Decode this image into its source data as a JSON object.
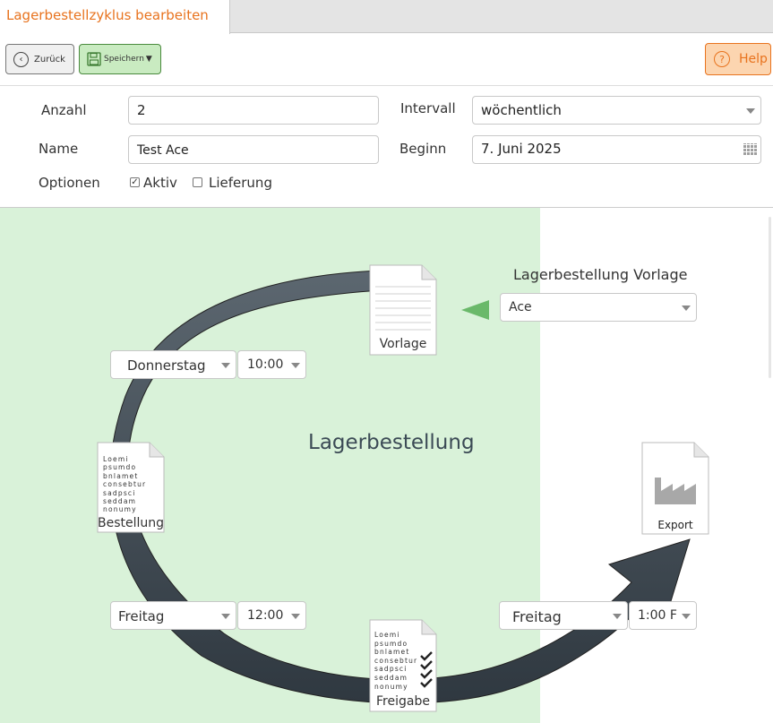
{
  "tab": {
    "title": "Lagerbestellzyklus bearbeiten"
  },
  "toolbar": {
    "back_label": "Zurück",
    "save_label": "Speichern",
    "help_label": "Help"
  },
  "form": {
    "anzahl_label": "Anzahl",
    "anzahl_value": "2",
    "intervall_label": "Intervall",
    "intervall_value": "wöchentlich",
    "name_label": "Name",
    "name_value": "Test Ace",
    "beginn_label": "Beginn",
    "beginn_value": "7. Juni 2025",
    "optionen_label": "Optionen",
    "aktiv_label": "Aktiv",
    "aktiv_checked": true,
    "lieferung_label": "Lieferung",
    "lieferung_checked": false
  },
  "diagram": {
    "title": "Lagerbestellung",
    "vorlage_label": "Lagerbestellung Vorlage",
    "vorlage_value": "Ace",
    "docs": {
      "vorlage": "Vorlage",
      "bestellung": "Bestellung",
      "freigabe": "Freigabe",
      "export": "Export"
    },
    "lorem_lines": [
      "Loemi",
      "psumdo",
      "bnlamet",
      "consebtur",
      "sadpsci",
      "seddam",
      "nonumy"
    ],
    "schedule": {
      "bestellung_day": "Donnerstag",
      "bestellung_time": "10:00",
      "freigabe_day": "Freitag",
      "freigabe_time": "12:00",
      "export_day": "Freitag",
      "export_time": "1:00 F"
    }
  },
  "colors": {
    "accent": "#e8731e",
    "green_panel": "#d9f2d9",
    "save_green": "#c9ebc1",
    "arrow_dark": "#37414a"
  }
}
